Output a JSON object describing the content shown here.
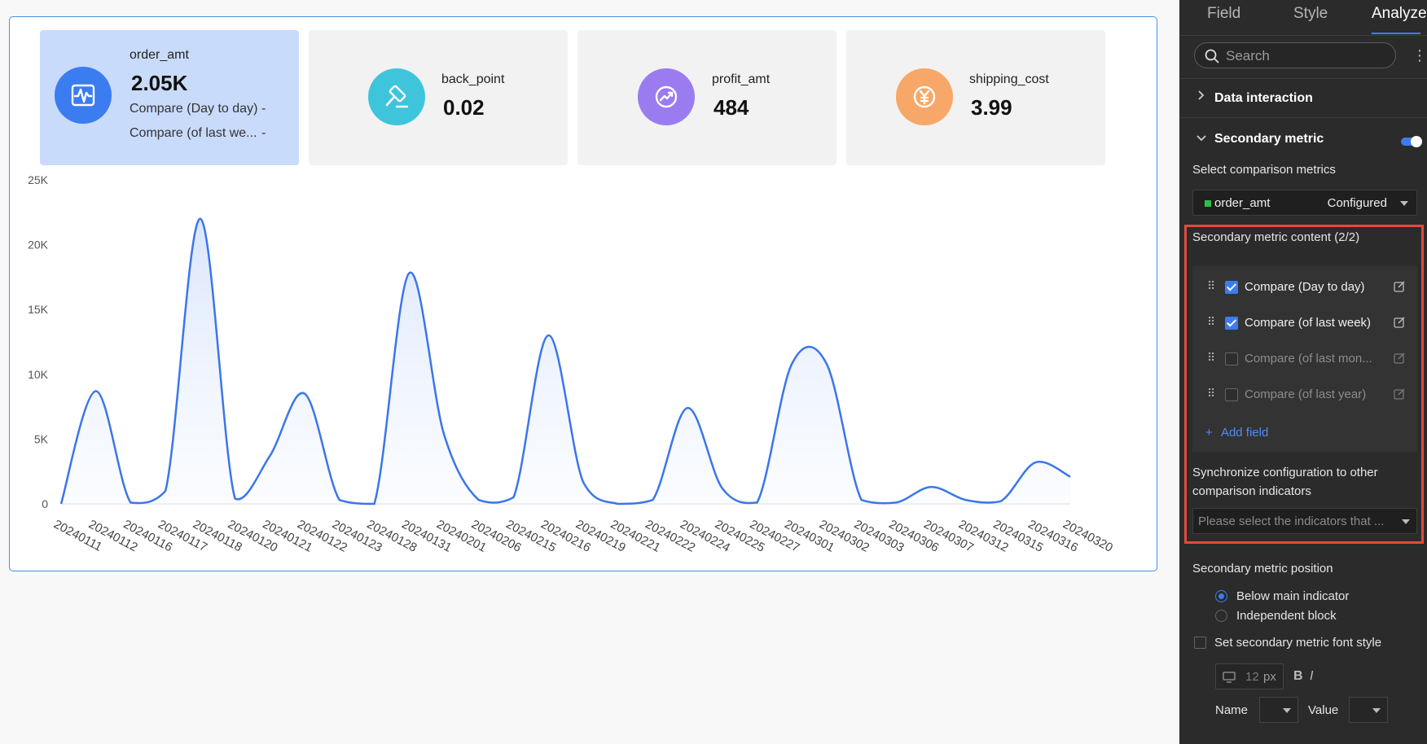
{
  "kpis": [
    {
      "name": "order_amt",
      "value": "2.05K",
      "icon": "pulse-icon",
      "color": "#3b7cf0",
      "compare": [
        {
          "label": "Compare (Day to day)",
          "value": "-"
        },
        {
          "label": "Compare (of last we...",
          "value": "-"
        }
      ]
    },
    {
      "name": "back_point",
      "value": "0.02",
      "icon": "gavel-icon",
      "color": "#3ec5dc"
    },
    {
      "name": "profit_amt",
      "value": "484",
      "icon": "trend-icon",
      "color": "#9a7cf0"
    },
    {
      "name": "shipping_cost",
      "value": "3.99",
      "icon": "yen-icon",
      "color": "#f7a868"
    }
  ],
  "chart_data": {
    "type": "area",
    "line_color": "#3b76ea",
    "y_ticks": [
      "25K",
      "20K",
      "15K",
      "10K",
      "5K",
      "0"
    ],
    "ylim": [
      0,
      25000
    ],
    "grid": false,
    "categories": [
      "20240111",
      "20240112",
      "20240116",
      "20240117",
      "20240118",
      "20240120",
      "20240121",
      "20240122",
      "20240123",
      "20240128",
      "20240131",
      "20240201",
      "20240206",
      "20240215",
      "20240216",
      "20240219",
      "20240221",
      "20240222",
      "20240224",
      "20240225",
      "20240227",
      "20240301",
      "20240302",
      "20240303",
      "20240306",
      "20240307",
      "20240312",
      "20240315",
      "20240316",
      "20240320"
    ],
    "values": [
      0,
      8700,
      100,
      1000,
      22000,
      400,
      3700,
      8500,
      300,
      0,
      17800,
      5400,
      300,
      500,
      13000,
      1700,
      0,
      300,
      7400,
      1200,
      100,
      10800,
      10800,
      300,
      100,
      1300,
      300,
      200,
      3200,
      2100
    ]
  },
  "panel": {
    "tabs": [
      "Field",
      "Style",
      "Analyze"
    ],
    "active_tab": "Analyze",
    "search_placeholder": "Search",
    "data_interaction": "Data interaction",
    "secondary_metric": "Secondary metric",
    "select_comparison": "Select comparison metrics",
    "comparison_metric": "order_amt",
    "comparison_status": "Configured",
    "content_title": "Secondary metric content (2/2)",
    "fields": [
      {
        "label": "Compare (Day to day)",
        "checked": true
      },
      {
        "label": "Compare (of last week)",
        "checked": true
      },
      {
        "label": "Compare (of last mon...",
        "checked": false
      },
      {
        "label": "Compare (of last year)",
        "checked": false
      }
    ],
    "add_field": "Add field",
    "sync_line1": "Synchronize configuration to other",
    "sync_line2": "comparison indicators",
    "sync_placeholder": "Please select the indicators that ...",
    "position_title": "Secondary metric position",
    "position_options": [
      "Below main indicator",
      "Independent block"
    ],
    "font_style_label": "Set secondary metric font style",
    "font_size": "12",
    "font_unit": "px",
    "bold": "B",
    "italic": "I",
    "name_label": "Name",
    "value_label": "Value"
  }
}
